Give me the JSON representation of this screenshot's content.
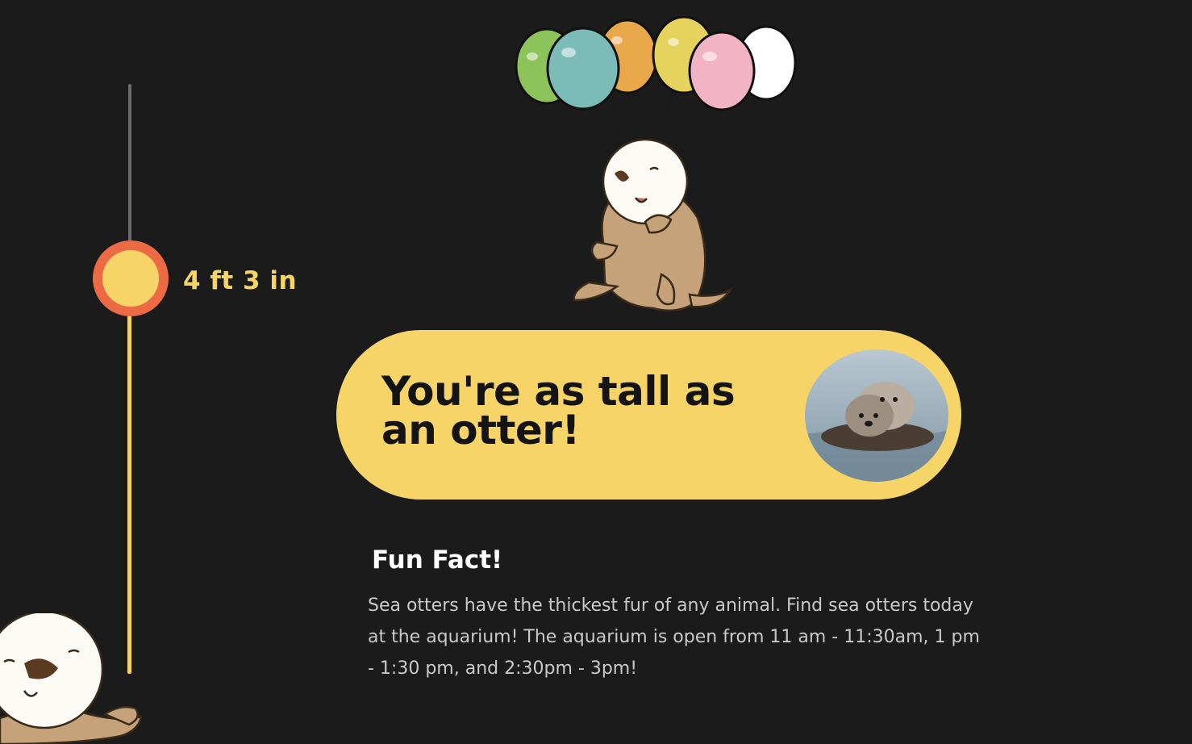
{
  "slider": {
    "height_label": "4 ft 3 in",
    "level_fraction": 0.32,
    "colors": {
      "thumb_ring": "#ec6b45",
      "thumb_fill": "#f6d468",
      "track_upper": "#6b6b6b",
      "track_lower": "#f5d168"
    }
  },
  "illustration": {
    "balloon_colors": [
      "#8cc35a",
      "#7bbcb8",
      "#e9a84a",
      "#e6d35e",
      "#f2b3c4",
      "#ffffff"
    ]
  },
  "result": {
    "title_line1": "You're as tall as",
    "title_line2": "an otter!",
    "card_color": "#f6d468",
    "photo_icon": "otter-photo"
  },
  "fun_fact": {
    "heading": "Fun Fact!",
    "body": "Sea otters have the thickest fur of any animal. Find sea otters today at the aquarium! The aquarium is open from 11 am - 11:30am, 1 pm - 1:30 pm, and 2:30pm - 3pm!"
  },
  "theme": {
    "background": "#1b1b1b",
    "accent": "#f6d468"
  }
}
